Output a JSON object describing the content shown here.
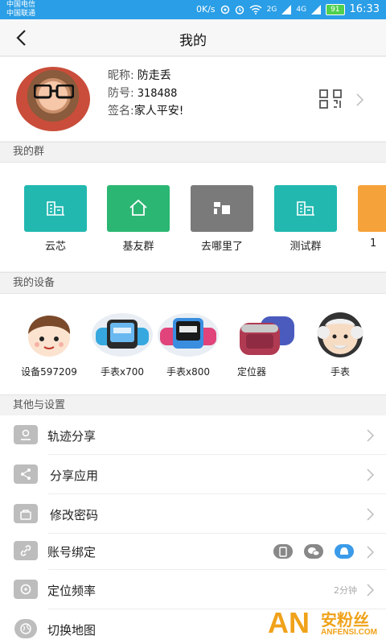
{
  "status_bar": {
    "carrier_1": "中国电信",
    "carrier_2": "中国联通",
    "speed": "0K/s",
    "signal_1": "2G",
    "signal_2": "4G",
    "battery": "91",
    "time": "16:33"
  },
  "header": {
    "title": "我的",
    "back_icon": "back-arrow-icon"
  },
  "profile": {
    "nickname_label": "昵称:",
    "nickname": "防走丢",
    "id_label": "防号:",
    "id": "318488",
    "signature_label": "签名:",
    "signature": "家人平安!",
    "qr_icon": "qr-code-icon"
  },
  "groups": {
    "section_title": "我的群",
    "items": [
      {
        "name": "云芯",
        "color": "#22b8b0",
        "icon": "building-icon"
      },
      {
        "name": "基友群",
        "color": "#2bb673",
        "icon": "home-icon"
      },
      {
        "name": "去哪里了",
        "color": "#7a7a7a",
        "icon": "layout-icon"
      },
      {
        "name": "测试群",
        "color": "#22b8b0",
        "icon": "building-icon"
      },
      {
        "name": "1",
        "color": "#f6a23a",
        "icon": "group-icon"
      }
    ]
  },
  "devices": {
    "section_title": "我的设备",
    "items": [
      {
        "name": "设备597209",
        "image": "cartoon-kid-avatar"
      },
      {
        "name": "手表x700",
        "image": "kids-smartwatch"
      },
      {
        "name": "手表x800",
        "image": "kids-smartwatch"
      },
      {
        "name": "定位器",
        "image": "gps-locator"
      },
      {
        "name": "手表",
        "image": "cartoon-grandpa-avatar"
      }
    ]
  },
  "settings": {
    "section_title": "其他与设置",
    "items": [
      {
        "label": "轨迹分享",
        "icon": "track-share-icon"
      },
      {
        "label": "分享应用",
        "icon": "share-icon"
      },
      {
        "label": "修改密码",
        "icon": "lock-icon"
      },
      {
        "label": "账号绑定",
        "icon": "link-icon"
      },
      {
        "label": "定位频率",
        "icon": "frequency-icon",
        "value": "2分钟"
      },
      {
        "label": "切换地图",
        "icon": "globe-icon"
      }
    ],
    "bind_icons": [
      "phone-icon",
      "wechat-icon",
      "qq-icon"
    ]
  },
  "watermark": {
    "logo": "AN",
    "cn": "安粉丝",
    "en": "ANFENSI.COM"
  }
}
